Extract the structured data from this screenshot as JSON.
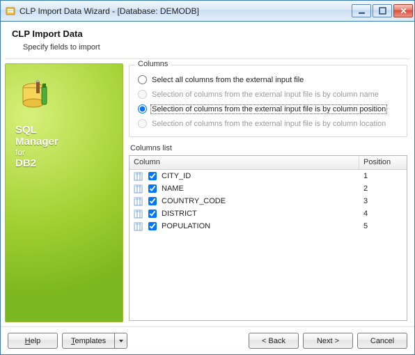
{
  "window": {
    "title": "CLP Import Data Wizard - [Database: DEMODB]"
  },
  "header": {
    "title": "CLP Import Data",
    "subtitle": "Specify fields to import"
  },
  "sidebar": {
    "line1": "SQL",
    "line2": "Manager",
    "line3": "for",
    "line4": "DB2"
  },
  "columns_group": {
    "legend": "Columns",
    "options": [
      {
        "label": "Select all columns from the external input file",
        "enabled": true,
        "selected": false
      },
      {
        "label": "Selection of columns from the external input file is by column name",
        "enabled": false,
        "selected": false
      },
      {
        "label": "Selection of columns from the external input file is by column position",
        "enabled": true,
        "selected": true
      },
      {
        "label": "Selection of columns from the external input file is by column location",
        "enabled": false,
        "selected": false
      }
    ]
  },
  "columns_list": {
    "label": "Columns list",
    "headers": {
      "column": "Column",
      "position": "Position"
    },
    "rows": [
      {
        "name": "CITY_ID",
        "position": "1",
        "checked": true
      },
      {
        "name": "NAME",
        "position": "2",
        "checked": true
      },
      {
        "name": "COUNTRY_CODE",
        "position": "3",
        "checked": true
      },
      {
        "name": "DISTRICT",
        "position": "4",
        "checked": true
      },
      {
        "name": "POPULATION",
        "position": "5",
        "checked": true
      }
    ]
  },
  "footer": {
    "help": "Help",
    "templates": "Templates",
    "back": "< Back",
    "next": "Next >",
    "cancel": "Cancel"
  }
}
